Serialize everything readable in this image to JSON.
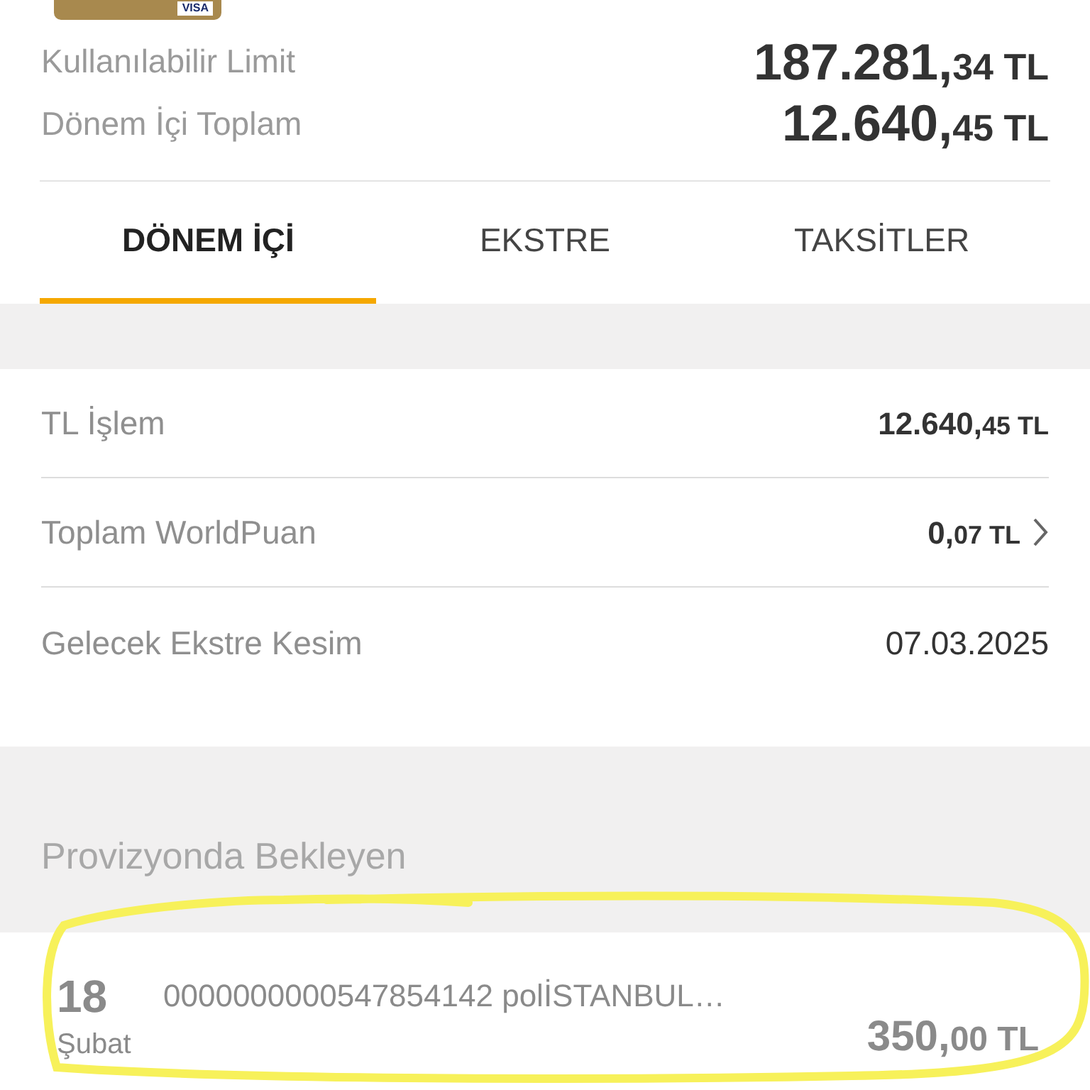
{
  "card": {
    "brand": "VISA"
  },
  "summary": [
    {
      "label": "Kullanılabilir Limit",
      "whole": "187.281,",
      "fraction": "34",
      "currency": "TL"
    },
    {
      "label": "Dönem İçi Toplam",
      "whole": "12.640,",
      "fraction": "45",
      "currency": "TL"
    }
  ],
  "tabs": [
    {
      "label": "DÖNEM İÇİ",
      "selected": true
    },
    {
      "label": "EKSTRE",
      "selected": false
    },
    {
      "label": "TAKSİTLER",
      "selected": false
    }
  ],
  "details": [
    {
      "kind": "amount",
      "label": "TL İşlem",
      "whole": "12.640,",
      "fraction": "45",
      "currency": "TL",
      "link": false
    },
    {
      "kind": "amount",
      "label": "Toplam WorldPuan",
      "whole": "0,",
      "fraction": "07",
      "currency": "TL",
      "link": true
    },
    {
      "kind": "text",
      "label": "Gelecek Ekstre Kesim",
      "value": "07.03.2025",
      "link": false
    }
  ],
  "pending": {
    "title": "Provizyonda Bekleyen",
    "transactions": [
      {
        "day": "18",
        "month": "Şubat",
        "description": "0000000000547854142 polİSTANBUL…",
        "whole": "350,",
        "fraction": "00",
        "currency": "TL"
      }
    ]
  },
  "annotation": {
    "kind": "scribble"
  }
}
